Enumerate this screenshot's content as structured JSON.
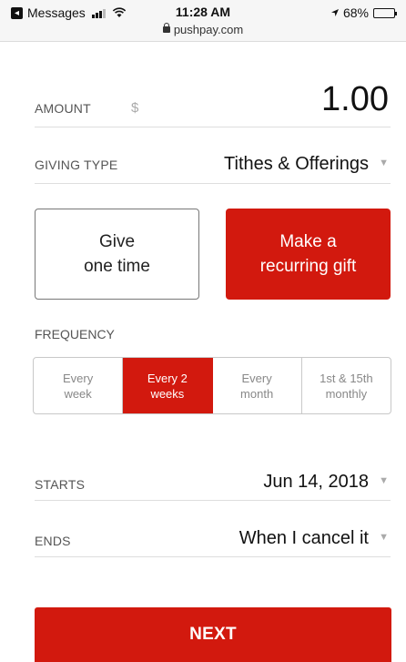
{
  "status_bar": {
    "back_app": "Messages",
    "time": "11:28 AM",
    "battery": "68%",
    "battery_level": 0.68,
    "url": "pushpay.com"
  },
  "form": {
    "amount": {
      "label": "AMOUNT",
      "currency": "$",
      "value": "1.00"
    },
    "giving_type": {
      "label": "GIVING TYPE",
      "value": "Tithes & Offerings"
    },
    "gift_options": [
      {
        "line1": "Give",
        "line2": "one time",
        "selected": false
      },
      {
        "line1": "Make a",
        "line2": "recurring gift",
        "selected": true
      }
    ],
    "frequency": {
      "label": "FREQUENCY",
      "options": [
        {
          "line1": "Every",
          "line2": "week",
          "selected": false
        },
        {
          "line1": "Every 2",
          "line2": "weeks",
          "selected": true
        },
        {
          "line1": "Every",
          "line2": "month",
          "selected": false
        },
        {
          "line1": "1st & 15th",
          "line2": "monthly",
          "selected": false
        }
      ]
    },
    "starts": {
      "label": "STARTS",
      "value": "Jun 14, 2018"
    },
    "ends": {
      "label": "ENDS",
      "value": "When I cancel it"
    },
    "next_label": "NEXT"
  },
  "colors": {
    "accent": "#d2190e"
  },
  "icons": {
    "caret": "caret-down-icon",
    "lock": "lock-icon",
    "wifi": "wifi-icon",
    "location": "location-arrow-icon"
  }
}
